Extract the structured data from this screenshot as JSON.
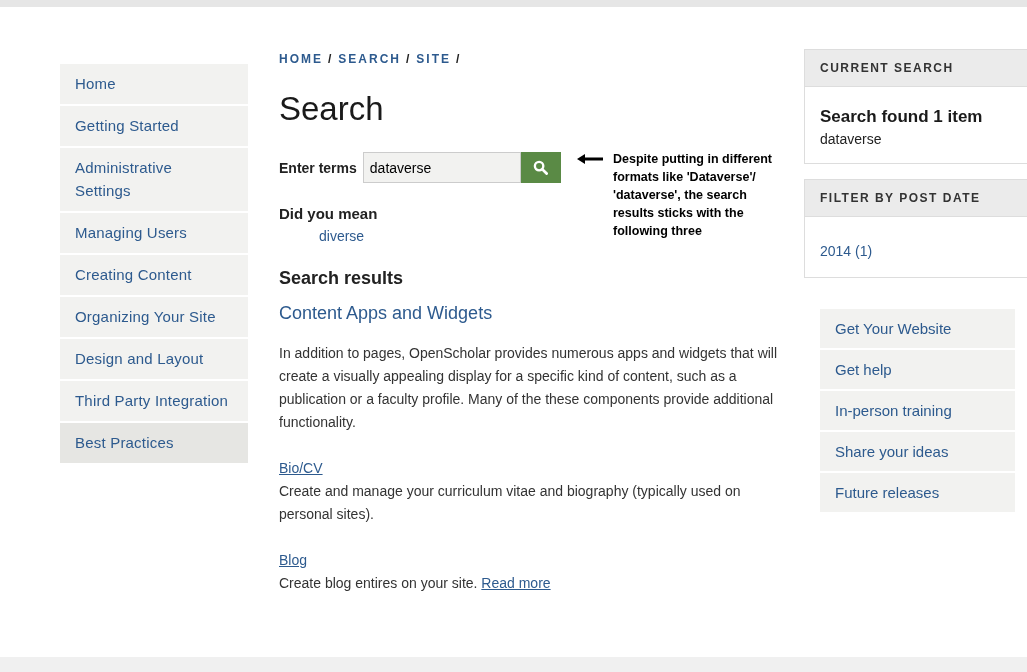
{
  "breadcrumb": [
    {
      "label": "HOME",
      "separator": "/"
    },
    {
      "label": "SEARCH",
      "separator": "/"
    },
    {
      "label": "SITE",
      "separator": "/"
    }
  ],
  "nav": [
    {
      "label": "Home",
      "selected": false
    },
    {
      "label": "Getting Started",
      "selected": false
    },
    {
      "label": "Administrative Settings",
      "selected": false
    },
    {
      "label": "Managing Users",
      "selected": false
    },
    {
      "label": "Creating Content",
      "selected": false
    },
    {
      "label": "Organizing Your Site",
      "selected": false
    },
    {
      "label": "Design and Layout",
      "selected": false
    },
    {
      "label": "Third Party Integration",
      "selected": false
    },
    {
      "label": "Best Practices",
      "selected": true
    }
  ],
  "title": "Search",
  "search": {
    "label": "Enter terms",
    "value": "dataverse"
  },
  "annotation": "Despite putting in different formats like 'Dataverse'/ 'dataverse', the search results sticks with the following three",
  "suggestion": {
    "heading": "Did you mean",
    "term": "diverse"
  },
  "results": {
    "heading": "Search results",
    "title": "Content Apps and Widgets",
    "intro": "In addition to pages, OpenScholar provides numerous apps and widgets that will create a visually appealing display for a specific kind of content, such as a publication or a faculty profile. Many of the these components provide additional functionality.",
    "items": [
      {
        "link": "Bio/CV",
        "text": "Create and manage your curriculum vitae and biography (typically used on personal sites)."
      },
      {
        "link": "Blog",
        "text": "Create blog entires on your site.",
        "more": "Read more"
      }
    ]
  },
  "current_search": {
    "heading": "CURRENT SEARCH",
    "summary": "Search found 1 item",
    "term": "dataverse"
  },
  "filter": {
    "heading": "FILTER BY POST DATE",
    "items": [
      "2014 (1)"
    ]
  },
  "links": [
    "Get Your Website",
    "Get help",
    "In-person training",
    "Share your ideas",
    "Future releases"
  ]
}
